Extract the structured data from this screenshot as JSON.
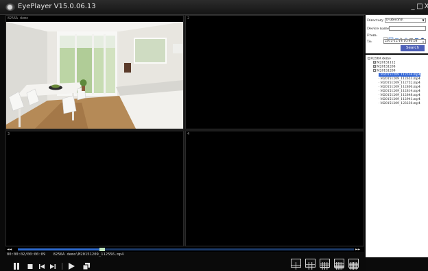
{
  "app": {
    "title": "EyePlayer V15.0.06.13"
  },
  "window_controls": {
    "minimize": "_",
    "maximize": "□",
    "close": "X"
  },
  "panes": [
    {
      "label": "8256A demo"
    },
    {
      "label": "2"
    },
    {
      "label": "3"
    },
    {
      "label": "4"
    }
  ],
  "playback": {
    "seek_left": "◄◄",
    "seek_right": "►►",
    "progress": 0.25,
    "time": "00:00:02/00:00:09",
    "file": "8256A demo\\M20151209_112556.mp4"
  },
  "controls": {
    "pause": "pause-icon",
    "stop": "stop-icon",
    "prev": "prev-icon",
    "next": "next-icon",
    "play": "play-icon",
    "snapshot": "copy-icon"
  },
  "layouts": [
    "layout-4",
    "layout-9",
    "layout-16",
    "layout-25",
    "layout-36"
  ],
  "search": {
    "directory_label": "Directory",
    "directory_value": "D:\\Record\\",
    "device_label": "Device name",
    "device_value": "",
    "from_label": "From:",
    "to_label": "To:",
    "to_value": "2015-12-14 10:40:54",
    "button": "Search"
  },
  "tree": [
    {
      "label": "8256A demo",
      "level": 0,
      "exp": "-"
    },
    {
      "label": "M20151112",
      "level": 1,
      "exp": "+"
    },
    {
      "label": "M20151208",
      "level": 1,
      "exp": "+"
    },
    {
      "label": "M20151209",
      "level": 1,
      "exp": "-"
    },
    {
      "label": "M20151209_112556.mp4",
      "level": 2,
      "selected": true
    },
    {
      "label": "M20151209_112653.mp4",
      "level": 2
    },
    {
      "label": "M20151209_112752.mp4",
      "level": 2
    },
    {
      "label": "M20151209_112800.mp4",
      "level": 2
    },
    {
      "label": "M20151209_112814.mp4",
      "level": 2
    },
    {
      "label": "M20151209_112848.mp4",
      "level": 2
    },
    {
      "label": "M20151209_112941.mp4",
      "level": 2
    },
    {
      "label": "M20151209_123230.mp4",
      "level": 2
    }
  ]
}
